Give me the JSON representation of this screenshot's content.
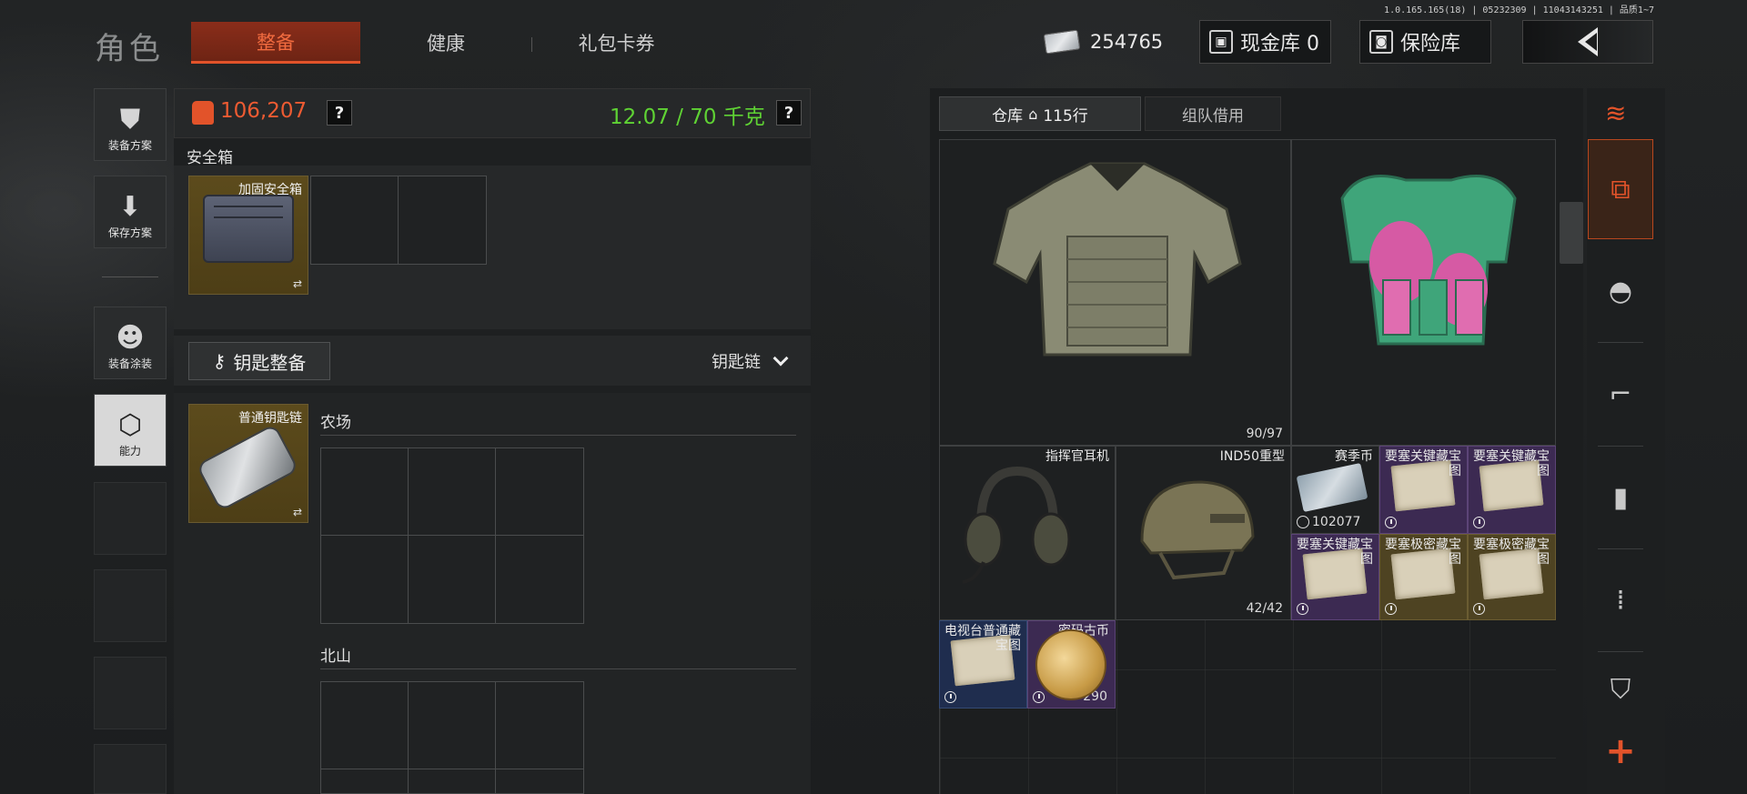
{
  "version": "1.0.165.165(18) | 05232309 | 11043143251 | 品质1~7",
  "header": {
    "title": "角色",
    "tabs": [
      {
        "label": "整备",
        "active": true
      },
      {
        "label": "健康",
        "active": false
      },
      {
        "label": "礼包卡券",
        "active": false
      }
    ],
    "money": "254765",
    "cash_vault_label": "现金库 0",
    "safe_label": "保险库"
  },
  "side_nav": [
    {
      "label": "装备方案",
      "icon": "vest-loadout-icon"
    },
    {
      "label": "保存方案",
      "icon": "download-icon"
    },
    {
      "label": "装备涂装",
      "icon": "helmet-paint-icon"
    },
    {
      "label": "能力",
      "icon": "lightning-hexagon-icon",
      "active": true
    }
  ],
  "equipment": {
    "armor_value": "106,207",
    "weight": "12.07 / 70 千克",
    "help": "?",
    "safebox_section": "安全箱",
    "safebox_item": "加固安全箱",
    "key_button": "钥匙整备",
    "key_dropdown": "钥匙链",
    "keyring_item": "普通钥匙链",
    "zones": [
      "农场",
      "北山"
    ],
    "swap_glyph": "⇄"
  },
  "warehouse": {
    "tabs": [
      {
        "label": "仓库",
        "rows": "115行",
        "active": true
      },
      {
        "label": "组队借用",
        "active": false
      }
    ],
    "items": [
      {
        "name": "",
        "durability": "90/97",
        "kind": "armor-vest"
      },
      {
        "name": "",
        "durability": "",
        "kind": "chest-rig"
      },
      {
        "name": "指挥官耳机",
        "durability": "",
        "kind": "headset"
      },
      {
        "name": "IND50重型",
        "durability": "42/42",
        "kind": "helmet"
      },
      {
        "name": "赛季币",
        "count": "102077",
        "kind": "season-cash"
      },
      {
        "name": "要塞关键藏宝图",
        "kind": "map",
        "rarity": "purple"
      },
      {
        "name": "要塞关键藏宝图",
        "kind": "map",
        "rarity": "purple"
      },
      {
        "name": "要塞关键藏宝图",
        "kind": "map",
        "rarity": "purple"
      },
      {
        "name": "要塞极密藏宝图",
        "kind": "map",
        "rarity": "gold"
      },
      {
        "name": "要塞极密藏宝图",
        "kind": "map",
        "rarity": "gold"
      },
      {
        "name": "电视台普通藏宝图",
        "kind": "map",
        "rarity": "blue"
      },
      {
        "name": "密码古币",
        "count": "290",
        "kind": "coin",
        "rarity": "purple"
      }
    ]
  },
  "categories": [
    {
      "name": "all-items-icon",
      "active": true
    },
    {
      "name": "helmet-icon"
    },
    {
      "name": "rifle-icon"
    },
    {
      "name": "magazine-icon"
    },
    {
      "name": "ammo-icon"
    },
    {
      "name": "armor-plate-icon"
    }
  ],
  "colors": {
    "accent": "#e2532a",
    "weight_ok": "#5fd234",
    "purple": "#3c2a52",
    "gold": "#4e4322",
    "blue": "#1f2d4e"
  }
}
